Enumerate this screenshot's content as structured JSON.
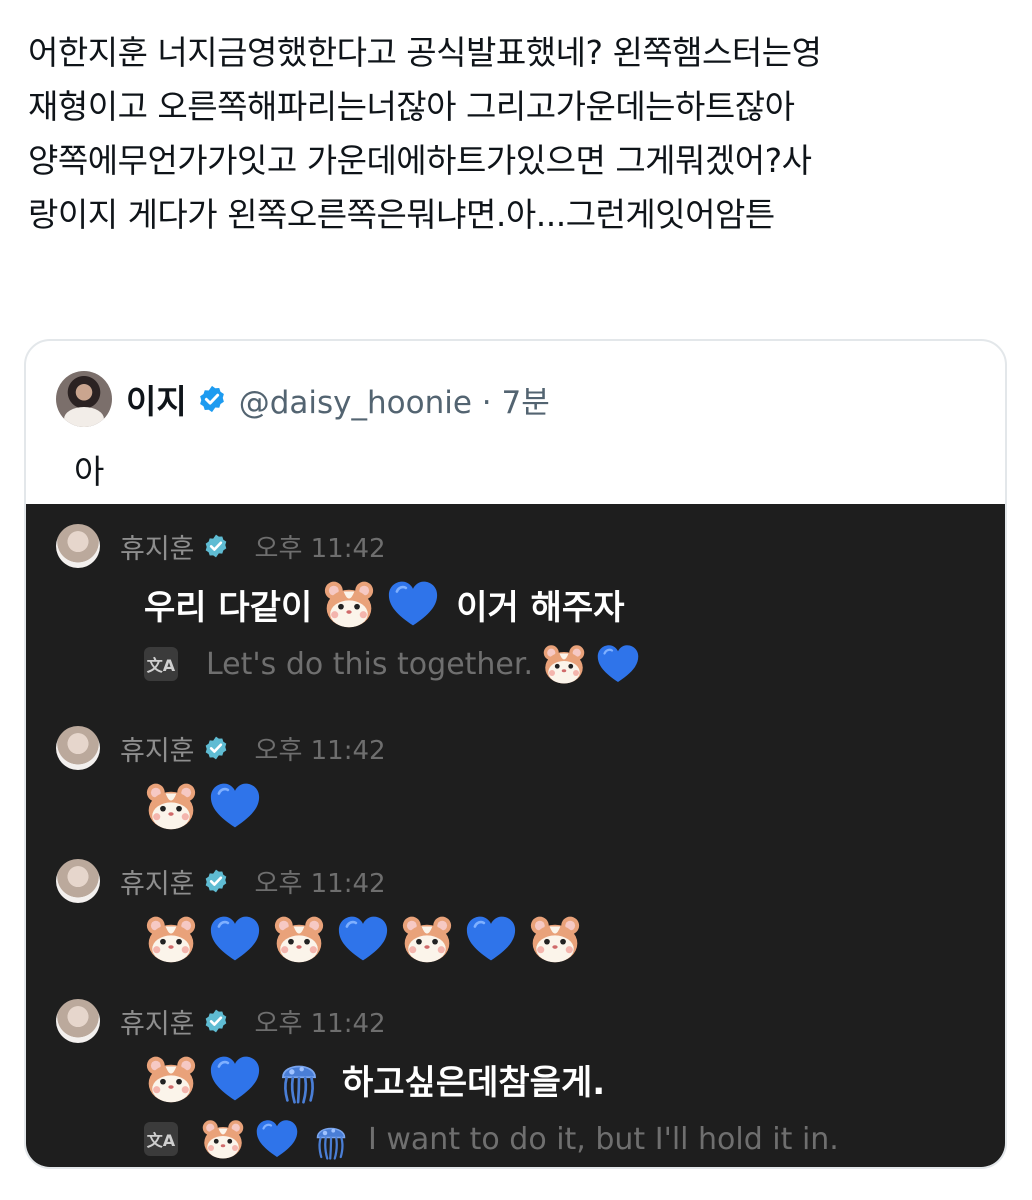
{
  "tweet": {
    "lines": [
      "어한지훈 너지금영했한다고 공식발표했네? 왼쪽햄스터는영",
      "재형이고 오른쪽해파리는너잖아 그리고가운데는하트잖아",
      "양쪽에무언가가잇고 가운데에하트가있으면 그게뭐겠어?사",
      "랑이지 게다가 왼쪽오른쪽은뭐냐면.아...그런게잇어암튼"
    ]
  },
  "quote": {
    "name": "이지",
    "handle": "@daisy_hoonie · 7분",
    "text": "아",
    "verified_color": "#1d9bf0"
  },
  "chat": {
    "background": "#1e1e1e",
    "badge_color": "#5fbcd3",
    "messages": [
      {
        "sender": "휴지훈",
        "time": "오후 11:42",
        "text_before": "우리 다같이",
        "emojis": [
          "hamster-icon",
          "blue-heart-icon"
        ],
        "text_after": "이거 해주자",
        "translate_icon": "文A",
        "translation": "Let's do this together."
      },
      {
        "sender": "휴지훈",
        "time": "오후 11:42",
        "emojis": [
          "hamster-icon",
          "blue-heart-icon"
        ]
      },
      {
        "sender": "휴지훈",
        "time": "오후 11:42",
        "emojis": [
          "hamster-icon",
          "blue-heart-icon",
          "hamster-icon",
          "blue-heart-icon",
          "hamster-icon",
          "blue-heart-icon",
          "hamster-icon"
        ]
      },
      {
        "sender": "휴지훈",
        "time": "오후 11:42",
        "emojis": [
          "hamster-icon",
          "blue-heart-icon",
          "jellyfish-icon"
        ],
        "text": "하고싶은데참을게.",
        "translate_icon": "文A",
        "translation": "I want to do it, but I'll hold it in."
      }
    ]
  }
}
